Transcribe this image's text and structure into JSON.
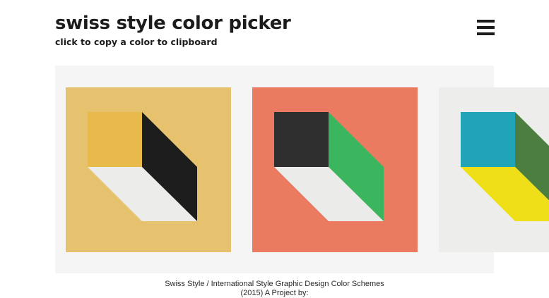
{
  "header": {
    "title": "swiss style color picker",
    "subtitle": "click to copy a color to clipboard"
  },
  "menu": {
    "icon": "hamburger-menu-icon"
  },
  "palettes": [
    {
      "name": "palette-1",
      "background": "#e6c26f",
      "top_face": "#e8b94b",
      "side_face": "#1d1d1d",
      "bottom_face": "#ececea"
    },
    {
      "name": "palette-2",
      "background": "#ea7a60",
      "top_face": "#2f2f2f",
      "side_face": "#3bb55e",
      "bottom_face": "#ebebe9"
    },
    {
      "name": "palette-3",
      "background": "#ededeb",
      "top_face": "#21a4b7",
      "side_face": "#4b7e3f",
      "bottom_face": "#efdf18"
    }
  ],
  "footer": {
    "line1": "Swiss Style / International Style Graphic Design Color Schemes",
    "line2": "(2015) A Project by:"
  }
}
